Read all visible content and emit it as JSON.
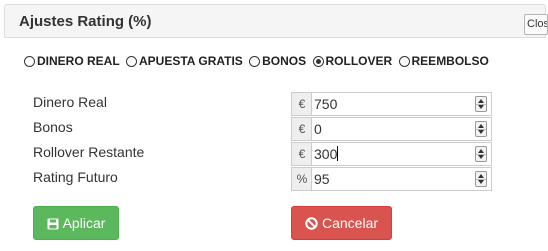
{
  "dialog": {
    "title": "Ajustes Rating (%)",
    "close_label": "Close"
  },
  "radios": [
    {
      "label": "DINERO REAL",
      "checked": false
    },
    {
      "label": "APUESTA GRATIS",
      "checked": false
    },
    {
      "label": "BONOS",
      "checked": false
    },
    {
      "label": "ROLLOVER",
      "checked": true
    },
    {
      "label": "REEMBOLSO",
      "checked": false
    }
  ],
  "fields": [
    {
      "label": "Dinero Real",
      "addon": "€",
      "value": "750"
    },
    {
      "label": "Bonos",
      "addon": "€",
      "value": "0"
    },
    {
      "label": "Rollover Restante",
      "addon": "€",
      "value": "300"
    },
    {
      "label": "Rating Futuro",
      "addon": "%",
      "value": "95"
    }
  ],
  "buttons": {
    "apply_label": "Aplicar",
    "cancel_label": "Cancelar"
  },
  "colors": {
    "apply": "#5cb85c",
    "cancel": "#d9534f"
  },
  "icons": {
    "apply": "save-icon",
    "cancel": "ban-icon"
  }
}
